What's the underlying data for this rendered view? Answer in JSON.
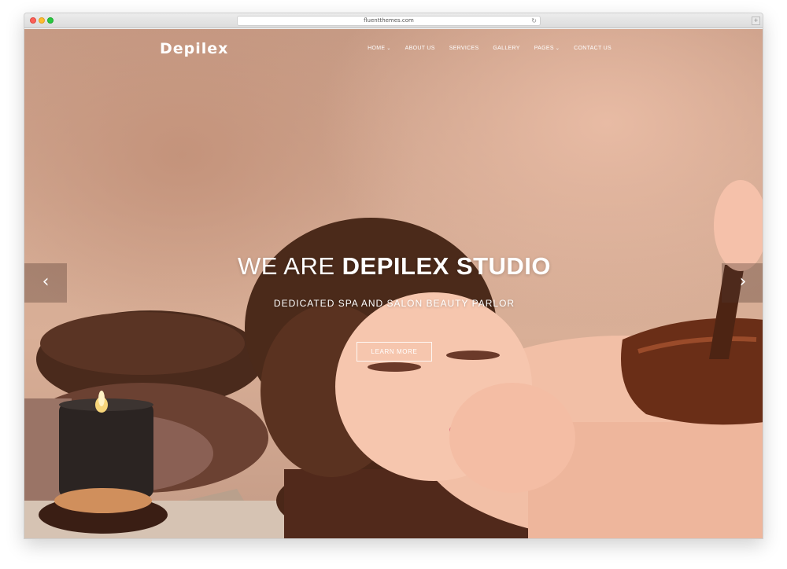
{
  "browser": {
    "url": "fluentthemes.com",
    "reload_icon": "reload-icon",
    "new_tab_symbol": "+"
  },
  "site": {
    "logo": "Depilex",
    "nav": [
      {
        "label": "HOME",
        "has_dropdown": true
      },
      {
        "label": "ABOUT US",
        "has_dropdown": false
      },
      {
        "label": "SERVICES",
        "has_dropdown": false
      },
      {
        "label": "GALLERY",
        "has_dropdown": false
      },
      {
        "label": "PAGES",
        "has_dropdown": true
      },
      {
        "label": "CONTACT US",
        "has_dropdown": false
      }
    ]
  },
  "hero": {
    "headline_light": "WE ARE ",
    "headline_bold": "DEPILEX STUDIO",
    "subheadline": "DEDICATED SPA AND SALON BEAUTY PARLOR",
    "cta_label": "LEARN MORE",
    "prev_arrow": "‹",
    "next_arrow": "›"
  },
  "colors": {
    "background": "#d5ab94",
    "text": "#ffffff"
  }
}
